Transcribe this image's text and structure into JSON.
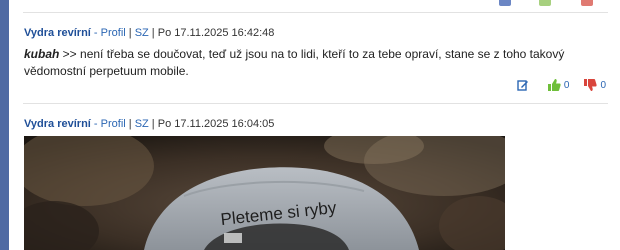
{
  "colors": {
    "left_bar": "#4f6aa3",
    "author": "#1f4f98",
    "link": "#2b66b3",
    "thumb_up": "#6fbf3a",
    "thumb_down": "#d9453c"
  },
  "posts": [
    {
      "author": "Vydra revírní",
      "separator": " - ",
      "profile_link": "Profil",
      "sz_link": "SZ",
      "timestamp": "Po 17.11.2025 16:42:48",
      "quote_name": "kubah",
      "text": " >> není třeba se doučovat, teď už jsou na to lidi, kteří to za tebe opraví, stane se z toho takový vědomostní perpetuum mobile.",
      "likes": "0",
      "dislikes": "0",
      "icons": {
        "edit": "edit-icon",
        "up": "thumbs-up-icon",
        "down": "thumbs-down-icon"
      }
    },
    {
      "author": "Vydra revírní",
      "separator": " - ",
      "profile_link": "Profil",
      "sz_link": "SZ",
      "timestamp": "Po 17.11.2025 16:04:05",
      "image_caption": "Pleteme si ryby"
    }
  ]
}
